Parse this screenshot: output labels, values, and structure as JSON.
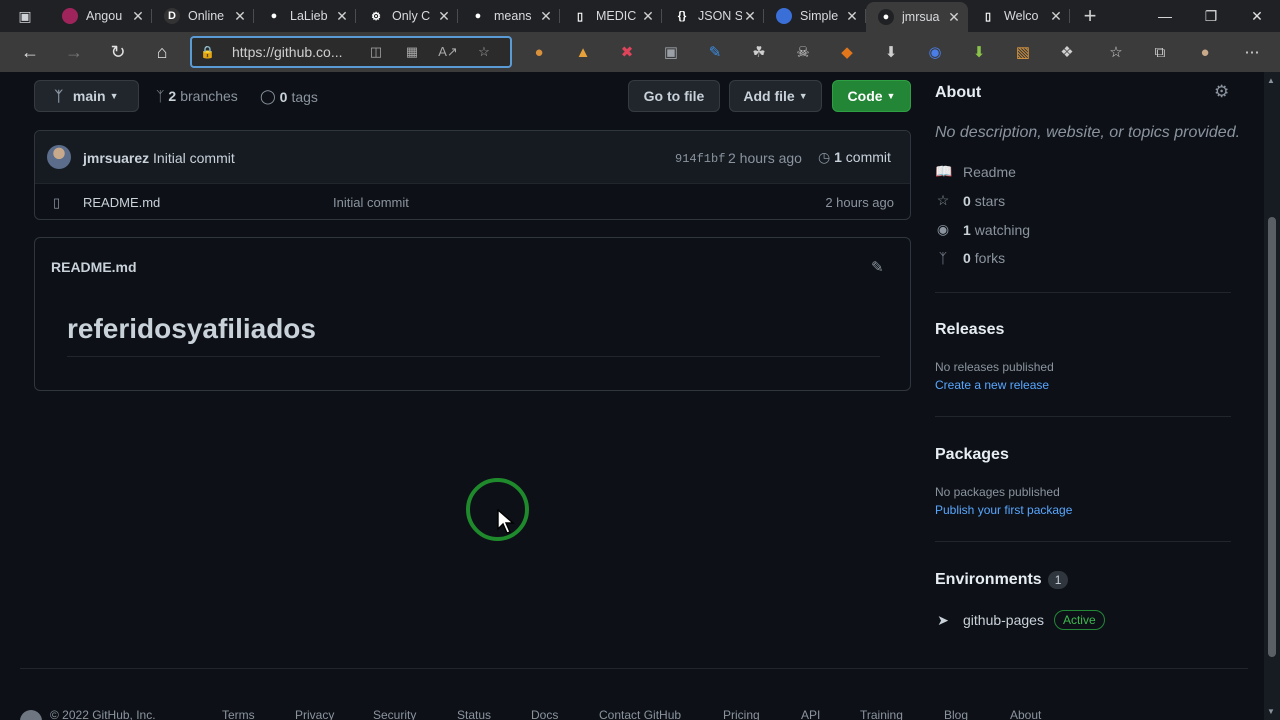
{
  "browser": {
    "tabs": [
      {
        "label": "Angou",
        "fav_color": "#a0245c",
        "fav_glyph": ""
      },
      {
        "label": "Online",
        "fav_color": "#333333",
        "fav_glyph": "D"
      },
      {
        "label": "LaLieb",
        "fav_color": "#202124",
        "fav_glyph": "●"
      },
      {
        "label": "Only C",
        "fav_color": "#202124",
        "fav_glyph": "⚙"
      },
      {
        "label": "means",
        "fav_color": "#202124",
        "fav_glyph": "●"
      },
      {
        "label": "MEDIC",
        "fav_color": "#202124",
        "fav_glyph": "▯"
      },
      {
        "label": "JSON S",
        "fav_color": "#202124",
        "fav_glyph": "{}"
      },
      {
        "label": "Simple",
        "fav_color": "#3a6fd8",
        "fav_glyph": ""
      },
      {
        "label": "jmrsua",
        "fav_color": "#202124",
        "fav_glyph": "●",
        "active": true
      },
      {
        "label": "Welco",
        "fav_color": "#202124",
        "fav_glyph": "▯"
      }
    ],
    "address_url": "https://github.co...",
    "extension_icons": [
      "cookie-icon",
      "pen-icon",
      "key-icon",
      "image-icon",
      "pencil-icon",
      "puzzle-icon",
      "skull-icon",
      "fox-icon",
      "download-icon",
      "chrome-icon",
      "arrow-down-icon",
      "wallet-icon",
      "extensions-icon",
      "favorites-icon",
      "collections-icon",
      "profile-icon",
      "more-icon"
    ]
  },
  "repo": {
    "branch": "main",
    "branches_count": "2",
    "branches_label": "branches",
    "tags_count": "0",
    "tags_label": "tags",
    "go_to_file": "Go to file",
    "add_file": "Add file",
    "code": "Code",
    "commit_author": "jmrsuarez",
    "commit_message": "Initial commit",
    "commit_hash": "914f1bf",
    "commit_time": "2 hours ago",
    "commit_count": "1",
    "commit_label": "commit",
    "files": [
      {
        "name": "README.md",
        "message": "Initial commit",
        "time": "2 hours ago"
      }
    ],
    "readme_title": "README.md",
    "readme_heading": "referidosyafiliados"
  },
  "about": {
    "title": "About",
    "description": "No description, website, or topics provided.",
    "readme": "Readme",
    "stars_count": "0",
    "stars_label": "stars",
    "watching_count": "1",
    "watching_label": "watching",
    "forks_count": "0",
    "forks_label": "forks"
  },
  "releases": {
    "title": "Releases",
    "empty": "No releases published",
    "link": "Create a new release"
  },
  "packages": {
    "title": "Packages",
    "empty": "No packages published",
    "link": "Publish your first package"
  },
  "environments": {
    "title": "Environments",
    "count": "1",
    "name": "github-pages",
    "status": "Active"
  },
  "footer": {
    "copyright": "© 2022 GitHub, Inc.",
    "links": [
      "Terms",
      "Privacy",
      "Security",
      "Status",
      "Docs",
      "Contact GitHub",
      "Pricing",
      "API",
      "Training",
      "Blog",
      "About"
    ]
  }
}
